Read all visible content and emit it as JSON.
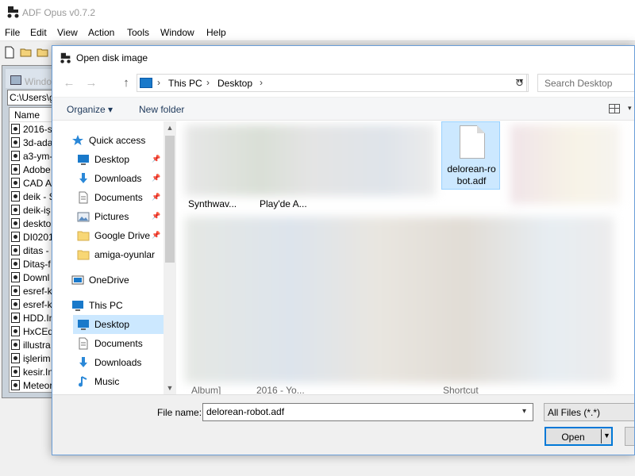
{
  "app": {
    "title": "ADF Opus v0.7.2",
    "menu": [
      "File",
      "Edit",
      "View",
      "Action",
      "Tools",
      "Window",
      "Help"
    ]
  },
  "inner_window": {
    "title": "Windo",
    "path": "C:\\Users\\g",
    "column_name": "Name",
    "files": [
      "2016-sl",
      "3d-ada",
      "a3-ym-",
      "Adobe",
      "CAD A",
      "deik - S",
      "deik-iş",
      "deskto",
      "DI0201",
      "ditas -",
      "Ditaş-f",
      "Downl",
      "esref-k",
      "esref-k",
      "HDD.In",
      "HxCEd",
      "illustra",
      "işlerim",
      "kesir.In",
      "Meteor"
    ]
  },
  "dialog": {
    "title": "Open disk image",
    "breadcrumb": [
      "This PC",
      "Desktop"
    ],
    "search_placeholder": "Search Desktop",
    "organize_label": "Organize",
    "new_folder_label": "New folder",
    "nav_pane": {
      "quick_access": "Quick access",
      "quick_items": [
        "Desktop",
        "Downloads",
        "Documents",
        "Pictures",
        "Google Drive",
        "amiga-oyunlar"
      ],
      "onedrive": "OneDrive",
      "this_pc": "This PC",
      "pc_items": [
        "Desktop",
        "Documents",
        "Downloads",
        "Music"
      ]
    },
    "files": {
      "selected_file": "delorean-robot.adf",
      "selected_file_wrapped": "delorean-robot.adf",
      "tile_labels": [
        "Synthwav...",
        "Play'de A...",
        "Album]",
        "2016 - Yo...",
        "Shortcut"
      ]
    },
    "file_name_label": "File name:",
    "file_name_value": "delorean-robot.adf",
    "filter_value": "All Files (*.*)",
    "open_label": "Open"
  }
}
